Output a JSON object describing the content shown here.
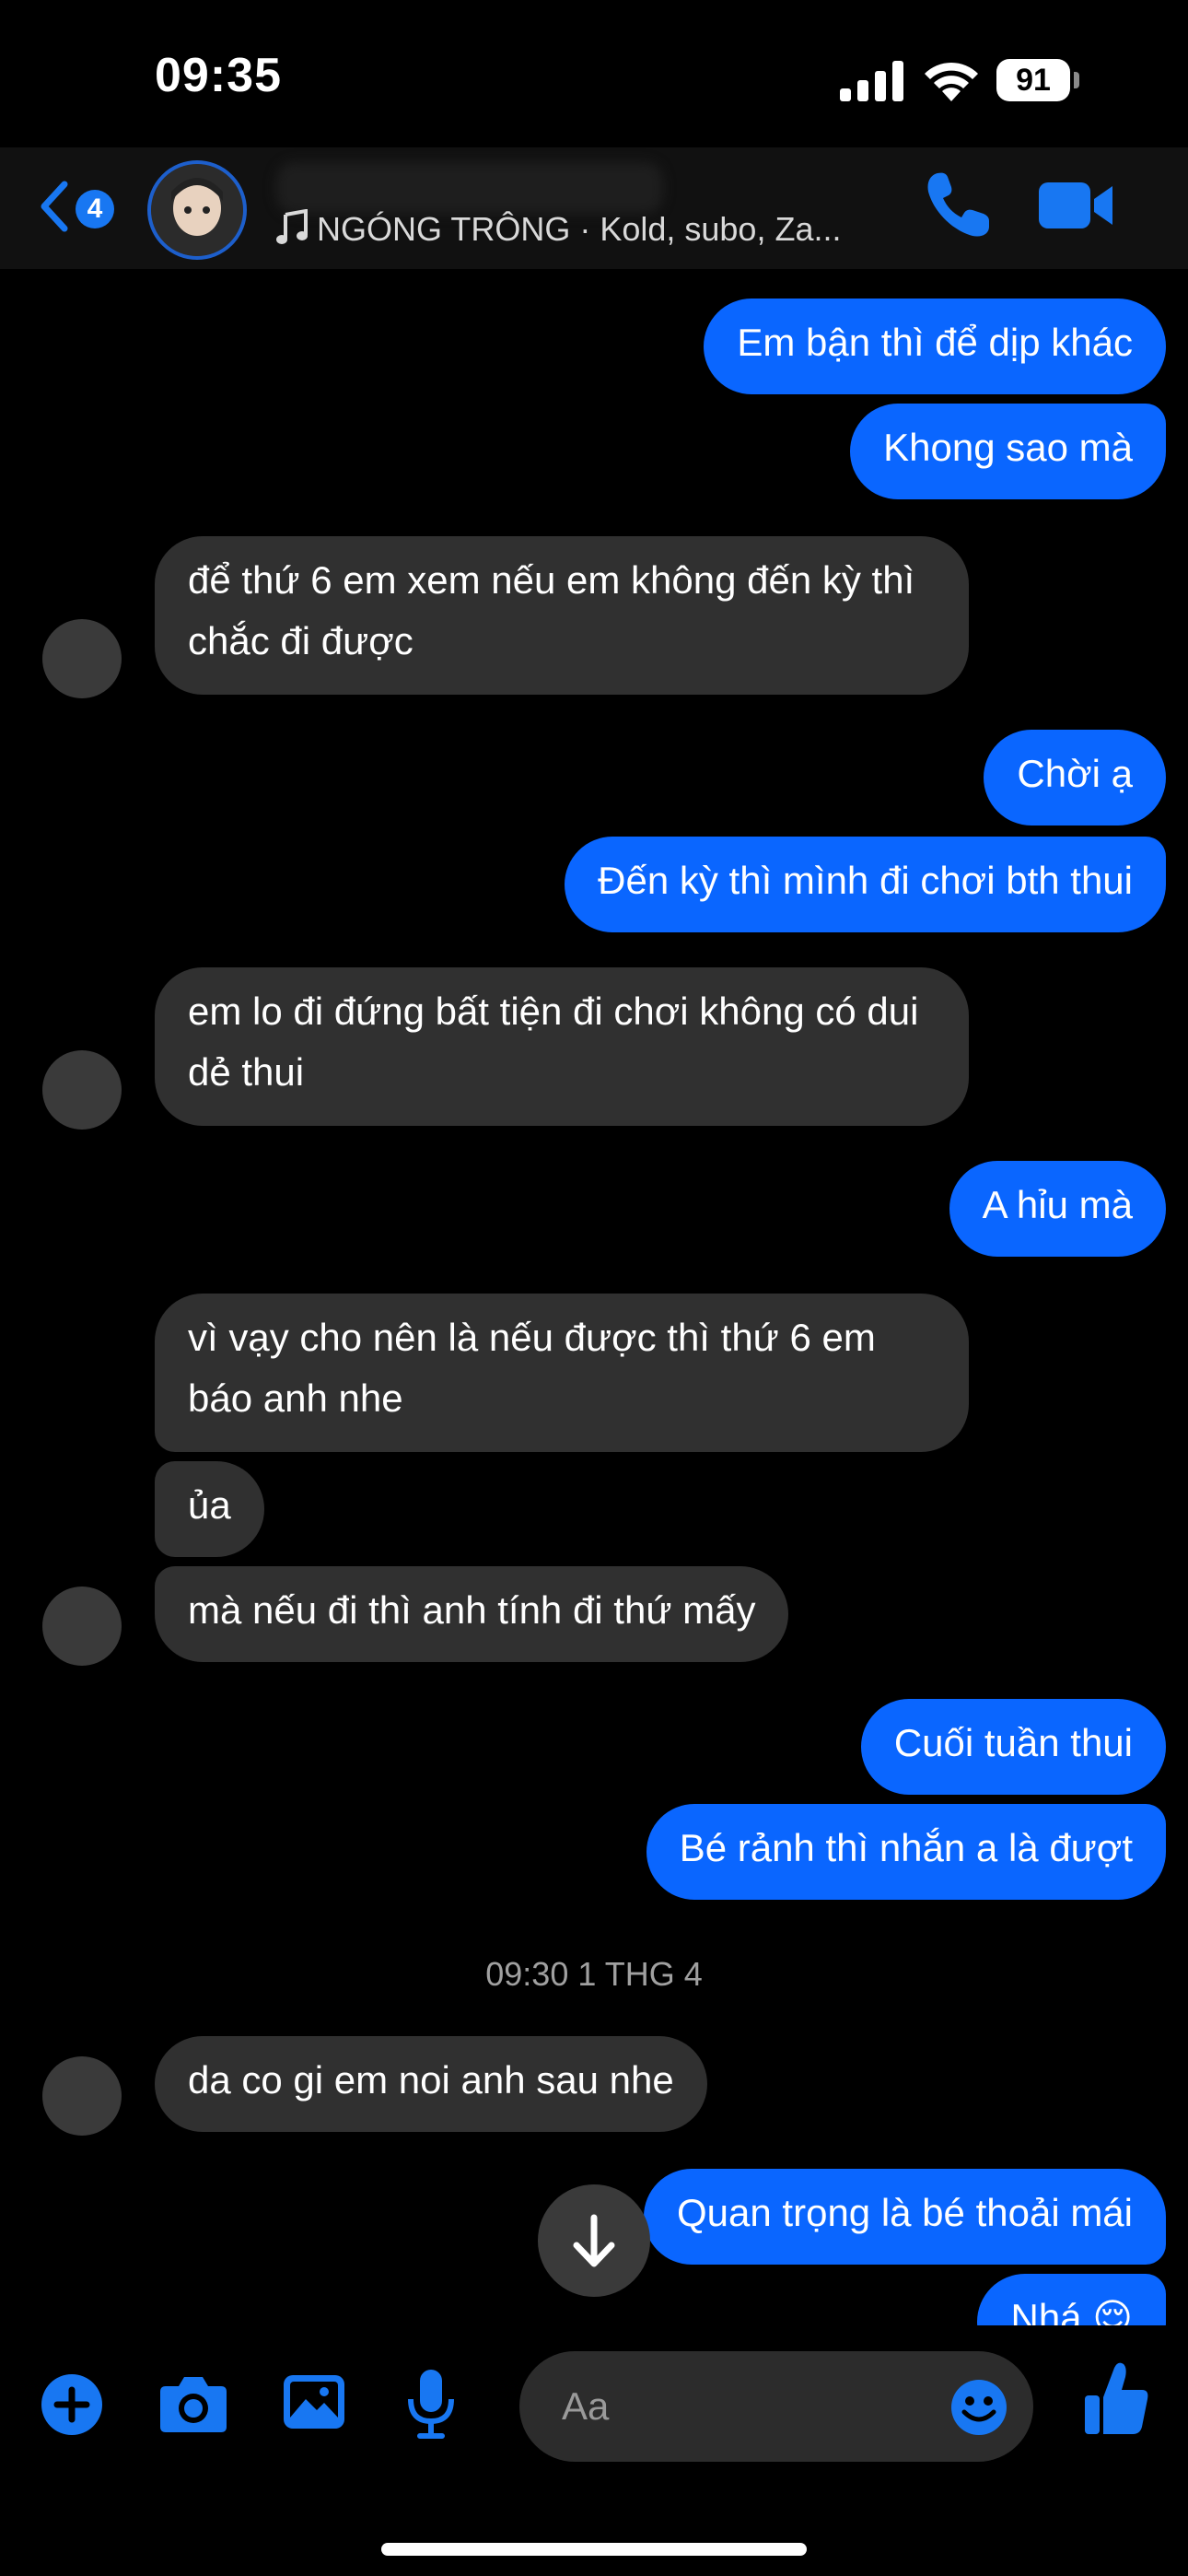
{
  "status_bar": {
    "time": "09:35",
    "battery": "91"
  },
  "header": {
    "back_badge": "4",
    "contact_name": "",
    "subtitle": "NGÓNG TRÔNG · Kold, subo, Za..."
  },
  "messages": [
    {
      "dir": "out",
      "text": "Em bận thì để dịp khác"
    },
    {
      "dir": "out",
      "text": "Khong sao mà"
    },
    {
      "dir": "in",
      "text": "để thứ 6 em xem nếu em không đến kỳ thì chắc đi được"
    },
    {
      "dir": "out",
      "text": "Chời ạ"
    },
    {
      "dir": "out",
      "text": "Đến kỳ thì mình đi chơi bth thui"
    },
    {
      "dir": "in",
      "text": "em lo đi đứng bất tiện đi chơi không có dui dẻ thui"
    },
    {
      "dir": "out",
      "text": "A hỉu mà"
    },
    {
      "dir": "in",
      "text": "vì vạy cho nên là nếu được thì thứ 6 em báo anh nhe"
    },
    {
      "dir": "in",
      "text": "ủa"
    },
    {
      "dir": "in",
      "text": "mà nếu đi thì anh tính đi thứ mấy"
    },
    {
      "dir": "out",
      "text": "Cuối tuần thui"
    },
    {
      "dir": "out",
      "text": "Bé rảnh thì nhắn a là đượt"
    },
    {
      "dir": "in",
      "text": "da co gi em noi anh sau nhe"
    },
    {
      "dir": "out",
      "text": "Quan trọng là bé thoải mái"
    },
    {
      "dir": "out",
      "text": "Nhá 😌"
    }
  ],
  "timestamp": "09:30 1 THG 4",
  "composer": {
    "placeholder": "Aa"
  },
  "colors": {
    "accent": "#0a66ff",
    "incoming": "#303030",
    "icon": "#1877f2"
  }
}
